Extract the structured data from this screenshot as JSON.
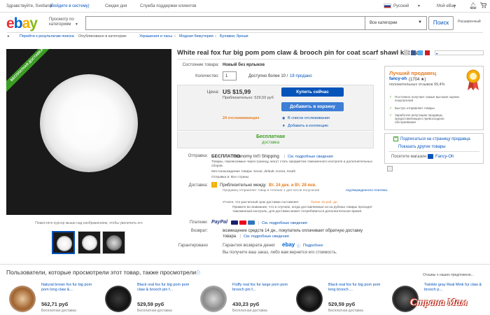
{
  "topbar": {
    "greeting": "Здравствуйте, Svetlana",
    "signin_link": "(Войдите в систему)",
    "deals": "Скидки дня",
    "support": "Служба поддержки клиентов",
    "language": "Русский",
    "my_ebay": "Мой eBay"
  },
  "header": {
    "logo": {
      "e": "e",
      "b": "b",
      "a": "a",
      "y": "y"
    },
    "browse_label": "Просмотр по категориям",
    "search_placeholder": "",
    "category_select": "Все категории",
    "search_button": "Поиск",
    "advanced": "Расширенный"
  },
  "breadcrumbs": [
    "Перейти к результатам поиска",
    "Опубликовано в категории:",
    "Украшения и часы",
    "Модная бижутерия",
    "Булавки, броши"
  ],
  "gallery": {
    "ribbon": "БЕСПЛАТНАЯ ДОСТАВКА",
    "caption": "Поместите курсор мыши над изображением, чтобы увеличить его"
  },
  "item": {
    "title": "White real fox fur big pom pom claw & brooch pin for coat scarf shawl kilt hat",
    "condition_label": "Состояние товара:",
    "condition_value": "Новый без ярлыков",
    "qty_label": "Количество:",
    "qty_value": "1",
    "available": "Доступно более 10 /",
    "sold": "18 продано",
    "price_label": "Цена:",
    "price": "US $15,99",
    "price_approx": "Приблизительно: 529,59 руб",
    "buy_now": "Купить сейчас",
    "add_to_cart": "Добавить в корзину",
    "watchers": "24 отслеживающих",
    "watch_list": "В список отслеживания",
    "add_collection": "Добавить в коллекцию",
    "free_shipping": "Бесплатная",
    "free_shipping_sub": "доставка"
  },
  "shipping": {
    "label": "Отправка:",
    "value": "БЕСПЛАТНО",
    "method": "Economy Int'l Shipping",
    "details_link": "См. подробные сведения",
    "note": "Товары, перевозимые через границу, могут стать предметом таможенного контроля и дополнительных сборов.",
    "location": "Местонахождение товара: Seoul, default, Korea, South",
    "countries": "Отправка в: Все страны"
  },
  "delivery": {
    "label": "Доставка:",
    "estimate": "Приблизительно между",
    "dates": "Вт. 24 дек. и Вт. 28 янв.",
    "note1": "Продавец отправляет товар в течение 1 дня после получения",
    "note1_link": "подтвержденного платежа.",
    "note2": "Учтите, что расчетный срок доставки составляет",
    "note2_highlight": "более 15 раб. дн.",
    "note3": "Примите во внимание, что в случаях, когда доставляемые из-за рубежа товары проходят таможенный контроль, для доставки может потребоваться дополнительное время."
  },
  "payments": {
    "label": "Платежи:",
    "paypal": "PayPal",
    "details_link": "См. подробные сведения"
  },
  "returns": {
    "label": "Возврат:",
    "text1": "возмещение средств 14 дн., покупатель оплачивает обратную доставку",
    "text2": "товара",
    "details_link": "См. подробные сведения"
  },
  "guarantee": {
    "label": "Гарантировано",
    "text": "Гарантия возврата денег",
    "ebay": "ebay",
    "more": "Подробнее",
    "note": "Вы получите ваш заказ, либо вам вернется его стоимость."
  },
  "seller": {
    "heading": "Лучший продавец",
    "name": "fancy-oh",
    "rating": "(1704 ★)",
    "positive": "положительных отзывов 99,4%",
    "points": [
      "Постоянно получает самые высокие оценки покупателей",
      "Быстро отправляет товары",
      "Заработал репутацию продавца, предоставляющего превосходное обслуживание"
    ],
    "subscribe": "Подписаться на страницу продавца",
    "other_items": "Показать другие товары",
    "store_label": "Посетите магазин:",
    "store_name": "Fancy-Oh"
  },
  "similar": {
    "heading": "Пользователи, которые просмотрели этот товар, также просмотрели",
    "feedback": "Отзывы о наших предложени...",
    "items": [
      {
        "name": "Natural brown fox fur big pom pom long claw &...",
        "price": "562,71 руб",
        "ship": "Бесплатная доставка"
      },
      {
        "name": "Black real fox fur big pom pom claw & brooch pin f...",
        "price": "529,59 руб",
        "ship": "Бесплатная доставка"
      },
      {
        "name": "Fluffy real fox fur large pom pom brooch pin f...",
        "price": "430,23 руб",
        "ship": "Бесплатная доставка"
      },
      {
        "name": "Black real fox fur big pom pom long brooch ...",
        "price": "529,59 руб",
        "ship": "Бесплатная доставка"
      },
      {
        "name": "Twinkle gray Real Mink fur claw & brooch p...",
        "price": "",
        "ship": ""
      }
    ]
  },
  "watermark": "Страна Мам"
}
